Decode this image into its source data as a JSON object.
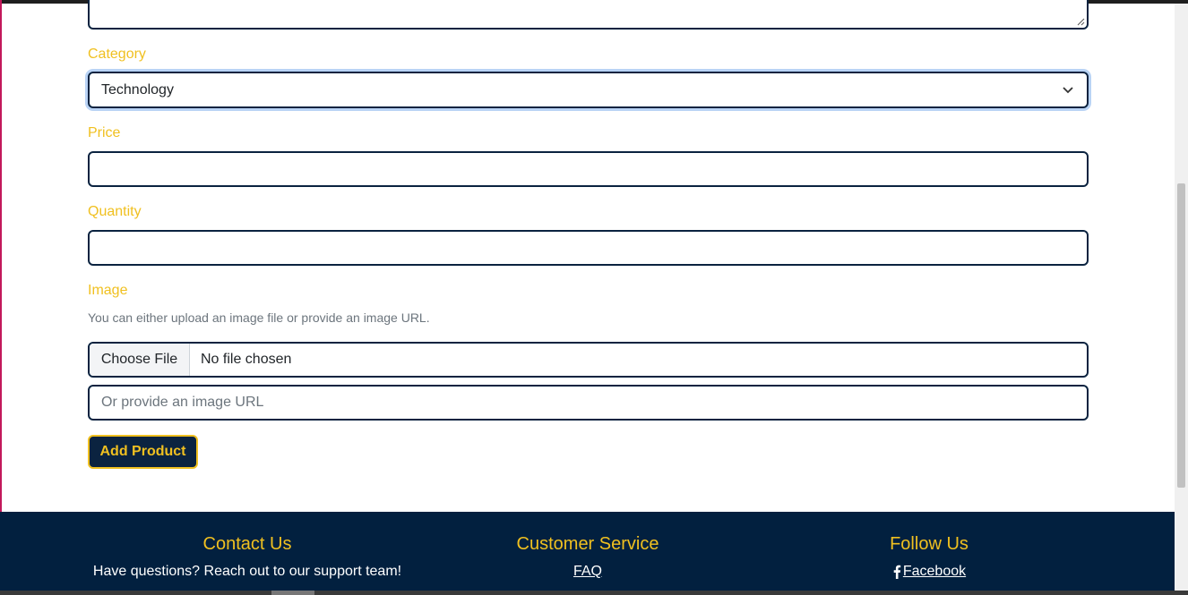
{
  "form": {
    "category_label": "Category",
    "category_value": "Technology",
    "price_label": "Price",
    "price_value": "",
    "quantity_label": "Quantity",
    "quantity_value": "",
    "image_label": "Image",
    "image_help": "You can either upload an image file or provide an image URL.",
    "file_button": "Choose File",
    "file_status": "No file chosen",
    "url_placeholder": "Or provide an image URL",
    "submit_label": "Add Product"
  },
  "footer": {
    "contact_heading": "Contact Us",
    "contact_text": "Have questions? Reach out to our support team!",
    "service_heading": "Customer Service",
    "service_links": [
      "FAQ"
    ],
    "follow_heading": "Follow Us",
    "follow_links": [
      "Facebook"
    ]
  },
  "icons": {
    "select": "chevron-down-icon",
    "social": "facebook-icon",
    "textarea": "resize-grip-icon"
  },
  "colors": {
    "accent": "#f0c020",
    "navy": "#0b2340",
    "footer_bg": "#02203f",
    "focus_ring": "#b9d3f5"
  }
}
